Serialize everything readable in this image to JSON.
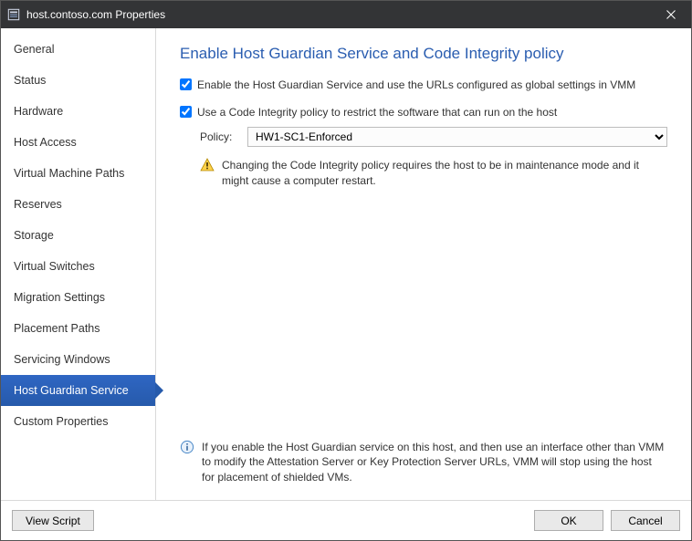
{
  "window": {
    "title": "host.contoso.com Properties"
  },
  "sidebar": {
    "items": [
      {
        "label": "General"
      },
      {
        "label": "Status"
      },
      {
        "label": "Hardware"
      },
      {
        "label": "Host Access"
      },
      {
        "label": "Virtual Machine Paths"
      },
      {
        "label": "Reserves"
      },
      {
        "label": "Storage"
      },
      {
        "label": "Virtual Switches"
      },
      {
        "label": "Migration Settings"
      },
      {
        "label": "Placement Paths"
      },
      {
        "label": "Servicing Windows"
      },
      {
        "label": "Host Guardian Service"
      },
      {
        "label": "Custom Properties"
      }
    ],
    "selected_index": 11
  },
  "main": {
    "heading": "Enable Host Guardian Service and Code Integrity policy",
    "enable_hgs": {
      "checked": true,
      "label": "Enable the Host Guardian Service and use the URLs configured as global settings in VMM"
    },
    "use_ci": {
      "checked": true,
      "label": "Use a Code Integrity policy to restrict the software that can run on the host"
    },
    "policy": {
      "label": "Policy:",
      "value": "HW1-SC1-Enforced"
    },
    "warning": {
      "text": "Changing the Code Integrity policy requires the host to be in maintenance mode and it might cause a computer restart."
    },
    "info": {
      "text": "If you enable the Host Guardian service on this host, and then use an interface other than VMM to modify the Attestation Server or Key Protection Server URLs, VMM will stop using the host for placement of shielded VMs."
    }
  },
  "footer": {
    "view_script": "View Script",
    "ok": "OK",
    "cancel": "Cancel"
  }
}
